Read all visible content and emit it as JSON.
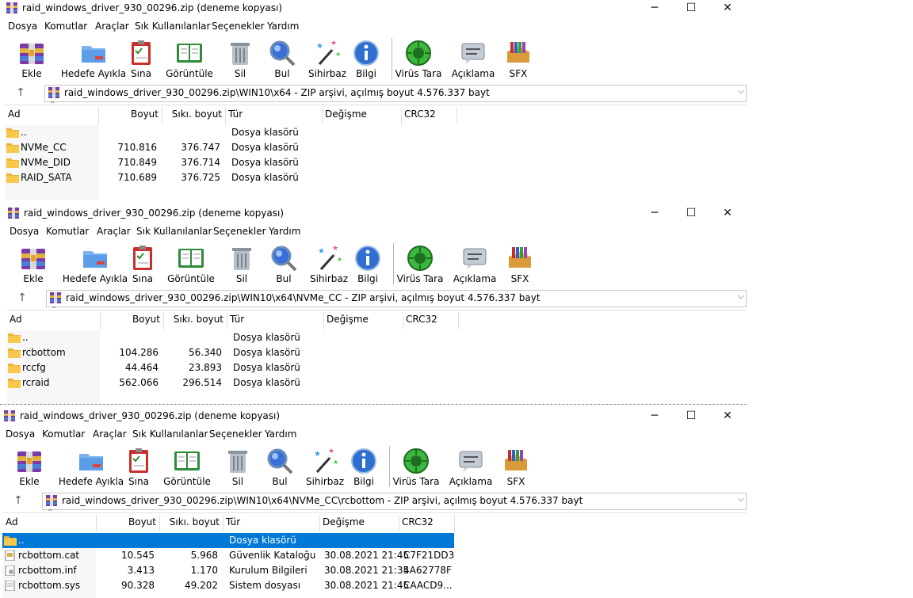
{
  "menu": [
    "Dosya",
    "Komutlar",
    "Araçlar",
    "Sık Kullanılanlar",
    "Seçenekler",
    "Yardım"
  ],
  "toolbar": [
    {
      "label": "Ekle",
      "icon": "add-archive-icon"
    },
    {
      "label": "Hedefe Ayıkla",
      "icon": "extract-to-icon"
    },
    {
      "label": "Sına",
      "icon": "test-icon"
    },
    {
      "label": "Görüntüle",
      "icon": "view-icon"
    },
    {
      "label": "Sil",
      "icon": "delete-icon"
    },
    {
      "label": "Bul",
      "icon": "find-icon"
    },
    {
      "label": "Sihirbaz",
      "icon": "wizard-icon"
    },
    {
      "label": "Bilgi",
      "icon": "info-icon"
    },
    {
      "label": "Virüs Tara",
      "icon": "virus-scan-icon"
    },
    {
      "label": "Açıklama",
      "icon": "comment-icon"
    },
    {
      "label": "SFX",
      "icon": "sfx-icon"
    }
  ],
  "columns": [
    "Ad",
    "Boyut",
    "Sıkı. boyut",
    "Tür",
    "Değişme",
    "CRC32"
  ],
  "window_controls": {
    "minimize": "─",
    "maximize": "☐",
    "close": "✕"
  },
  "up_symbol": "↑",
  "dropdown_symbol": "⌵",
  "windows": [
    {
      "title": "raid_windows_driver_930_00296.zip (deneme kopyası)",
      "path": "raid_windows_driver_930_00296.zip\\WIN10\\x64 - ZIP arşivi, açılmış boyut 4.576.337 bayt",
      "rows": [
        {
          "name": "..",
          "size": "",
          "packed": "",
          "type": "Dosya klasörü",
          "modified": "",
          "crc": "",
          "icon": "folder"
        },
        {
          "name": "NVMe_CC",
          "size": "710.816",
          "packed": "376.747",
          "type": "Dosya klasörü",
          "modified": "",
          "crc": "",
          "icon": "folder"
        },
        {
          "name": "NVMe_DID",
          "size": "710.849",
          "packed": "376.714",
          "type": "Dosya klasörü",
          "modified": "",
          "crc": "",
          "icon": "folder"
        },
        {
          "name": "RAID_SATA",
          "size": "710.689",
          "packed": "376.725",
          "type": "Dosya klasörü",
          "modified": "",
          "crc": "",
          "icon": "folder"
        }
      ]
    },
    {
      "title": "raid_windows_driver_930_00296.zip (deneme kopyası)",
      "path": "raid_windows_driver_930_00296.zip\\WIN10\\x64\\NVMe_CC - ZIP arşivi, açılmış boyut 4.576.337 bayt",
      "rows": [
        {
          "name": "..",
          "size": "",
          "packed": "",
          "type": "Dosya klasörü",
          "modified": "",
          "crc": "",
          "icon": "folder"
        },
        {
          "name": "rcbottom",
          "size": "104.286",
          "packed": "56.340",
          "type": "Dosya klasörü",
          "modified": "",
          "crc": "",
          "icon": "folder"
        },
        {
          "name": "rccfg",
          "size": "44.464",
          "packed": "23.893",
          "type": "Dosya klasörü",
          "modified": "",
          "crc": "",
          "icon": "folder"
        },
        {
          "name": "rcraid",
          "size": "562.066",
          "packed": "296.514",
          "type": "Dosya klasörü",
          "modified": "",
          "crc": "",
          "icon": "folder"
        }
      ]
    },
    {
      "title": "raid_windows_driver_930_00296.zip (deneme kopyası)",
      "path": "raid_windows_driver_930_00296.zip\\WIN10\\x64\\NVMe_CC\\rcbottom - ZIP arşivi, açılmış boyut 4.576.337 bayt",
      "rows": [
        {
          "name": "..",
          "size": "",
          "packed": "",
          "type": "Dosya klasörü",
          "modified": "",
          "crc": "",
          "icon": "folder",
          "selected": true
        },
        {
          "name": "rcbottom.cat",
          "size": "10.545",
          "packed": "5.968",
          "type": "Güvenlik Kataloğu",
          "modified": "30.08.2021 21:45",
          "crc": "C7F21DD3",
          "icon": "catalog"
        },
        {
          "name": "rcbottom.inf",
          "size": "3.413",
          "packed": "1.170",
          "type": "Kurulum Bilgileri",
          "modified": "30.08.2021 21:35",
          "crc": "4A62778F",
          "icon": "setup"
        },
        {
          "name": "rcbottom.sys",
          "size": "90.328",
          "packed": "49.202",
          "type": "Sistem dosyası",
          "modified": "30.08.2021 21:45",
          "crc": "CAACD9..."
        }
      ]
    }
  ],
  "colors": {
    "selection": "#0078d7",
    "folder": "#f8c84a"
  }
}
